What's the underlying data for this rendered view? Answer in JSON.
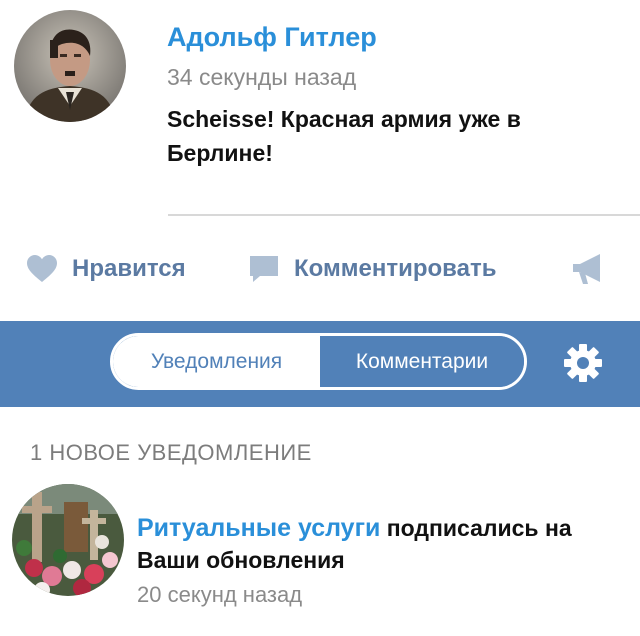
{
  "post": {
    "author": "Адольф Гитлер",
    "time": "34 секунды назад",
    "text": "Scheisse! Красная армия уже в Берлине!"
  },
  "actions": {
    "like_label": "Нравится",
    "comment_label": "Комментировать"
  },
  "tabs": {
    "notifications": "Уведомления",
    "comments": "Комментарии"
  },
  "notifications": {
    "section_title": "1 НОВОЕ УВЕДОМЛЕНИЕ",
    "items": [
      {
        "name": "Ритуальные услуги",
        "action": "подписались на Ваши обновления",
        "time": "20 секунд назад"
      }
    ]
  },
  "colors": {
    "accent_blue": "#2a8fd9",
    "bar_blue": "#5181b8",
    "action_blue": "#5b7aa2",
    "gray_text": "#8a8a8a"
  }
}
